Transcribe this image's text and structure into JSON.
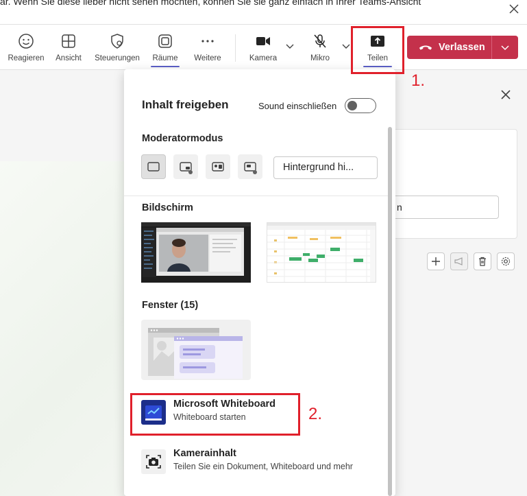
{
  "banner": {
    "text": "ar. Wenn Sie diese lieber nicht sehen möchten, können Sie sie ganz einfach in Ihrer Teams-Ansicht"
  },
  "toolbar": {
    "react": "Reagieren",
    "view": "Ansicht",
    "controls": "Steuerungen",
    "rooms": "Räume",
    "more": "Weitere",
    "camera": "Kamera",
    "mic": "Mikro",
    "share": "Teilen",
    "leave": "Verlassen"
  },
  "annotations": {
    "first": "1.",
    "second": "2."
  },
  "share_panel": {
    "title": "Inhalt freigeben",
    "sound_label": "Sound einschließen",
    "sound_on": false,
    "presenter_mode": "Moderatormodus",
    "background_button": "Hintergrund hi...",
    "screen": "Bildschirm",
    "windows": "Fenster (15)",
    "whiteboard_title": "Microsoft Whiteboard",
    "whiteboard_sub": "Whiteboard starten",
    "camera_title": "Kamerainhalt",
    "camera_sub": "Teilen Sie ein Dokument, Whiteboard und mehr"
  },
  "right_panel": {
    "input_value": "n"
  },
  "colors": {
    "accent": "#5b5fc7",
    "leave": "#c4314b",
    "annotation": "#e0202b"
  }
}
